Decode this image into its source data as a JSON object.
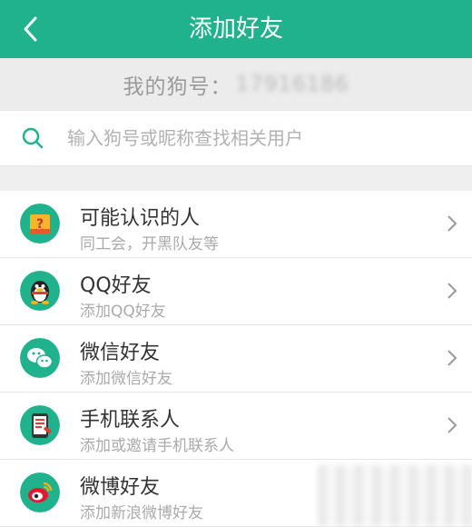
{
  "header": {
    "title": "添加好友",
    "back_icon": "chevron-left-icon"
  },
  "account": {
    "label": "我的狗号：",
    "id": "17916186"
  },
  "search": {
    "placeholder": "输入狗号或昵称查找相关用户",
    "value": "",
    "icon": "search-icon"
  },
  "list": {
    "items": [
      {
        "label": "可能认识的人",
        "sub": "同工会，开黑队友等",
        "icon": "people-card-icon"
      },
      {
        "label": "QQ好友",
        "sub": "添加QQ好友",
        "icon": "qq-penguin-icon"
      },
      {
        "label": "微信好友",
        "sub": "添加微信好友",
        "icon": "wechat-icon"
      },
      {
        "label": "手机联系人",
        "sub": "添加或邀请手机联系人",
        "icon": "phone-contacts-icon"
      },
      {
        "label": "微博好友",
        "sub": "添加新浪微博好友",
        "icon": "weibo-icon"
      }
    ]
  },
  "colors": {
    "primary": "#1fb28d",
    "weibo_red": "#e6162d"
  }
}
